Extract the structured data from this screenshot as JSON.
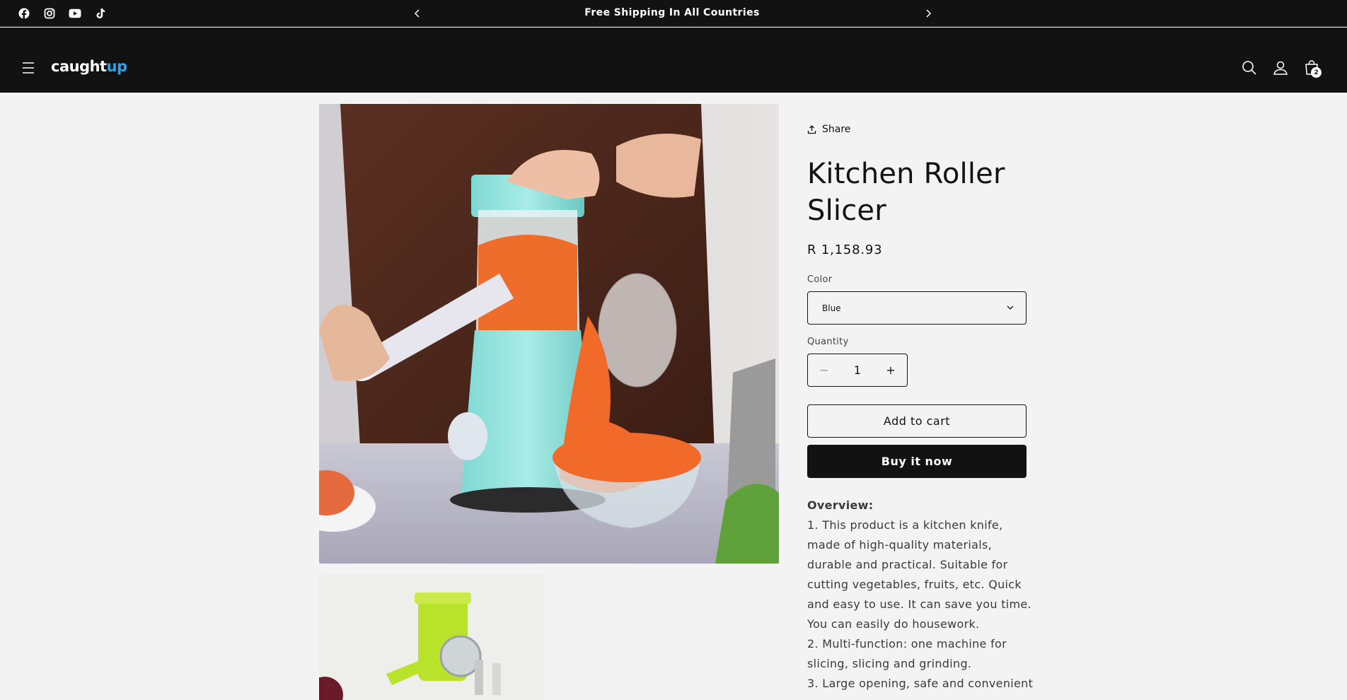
{
  "announcement": {
    "text": "Free Shipping In All Countries",
    "prev_icon": "chevron-left-icon",
    "next_icon": "chevron-right-icon"
  },
  "social": [
    "facebook-icon",
    "instagram-icon",
    "youtube-icon",
    "tiktok-icon"
  ],
  "header": {
    "logo_part1": "caught",
    "logo_part2": "up",
    "cart_count": "2",
    "icons": [
      "menu-icon",
      "search-icon",
      "account-icon",
      "cart-icon"
    ]
  },
  "product": {
    "share_label": "Share",
    "title": "Kitchen Roller Slicer",
    "price": "R 1,158.93",
    "color_label": "Color",
    "color_value": "Blue",
    "quantity_label": "Quantity",
    "quantity_value": "1",
    "minus_label": "−",
    "plus_label": "+",
    "add_to_cart": "Add to cart",
    "buy_now": "Buy it now",
    "overview_heading": "Overview:",
    "overview_lines": [
      "1. This product is a kitchen knife, made of high-quality materials, durable and practical. Suitable for cutting vegetables, fruits, etc. Quick and easy to use. It can save you time. You can easily do housework.",
      "2. Multi-function: one machine for slicing, slicing and grinding.",
      "3. Large opening, safe and convenient"
    ]
  },
  "colors": {
    "header_bg": "#121212",
    "page_bg": "#f3f3f3",
    "logo_accent": "#2aa3ee",
    "product_teal": "#8fe3df",
    "carrot": "#f26a2a"
  }
}
